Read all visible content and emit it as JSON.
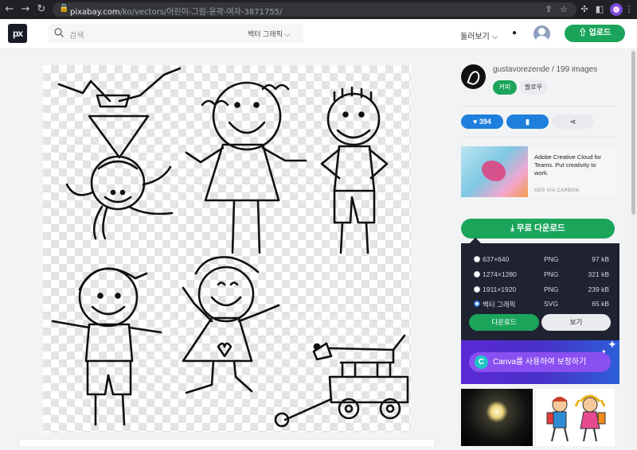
{
  "browser": {
    "url_host": "pixabay.com",
    "url_path": "/ko/vectors/어린이-그림-윤곽-여자-3871755/"
  },
  "header": {
    "logo": "px",
    "search_placeholder": "검색",
    "search_filter": "벡터 그래픽",
    "browse": "둘러보기",
    "upload": "업로드"
  },
  "author": {
    "name": "gustavorezende / 199 images",
    "coffee": "커피",
    "follow": "팔로우"
  },
  "actions": {
    "likes": "394"
  },
  "ad": {
    "text": "Adobe Creative Cloud for Teams. Put creativity to work.",
    "via": "ADS VIA CARBON"
  },
  "download": {
    "button": "무료 다운로드",
    "options": [
      {
        "size": "637×640",
        "format": "PNG",
        "filesize": "97 kB",
        "selected": false
      },
      {
        "size": "1274×1280",
        "format": "PNG",
        "filesize": "321 kB",
        "selected": false
      },
      {
        "size": "1911×1920",
        "format": "PNG",
        "filesize": "239 kB",
        "selected": false
      },
      {
        "size": "벡터 그래픽",
        "format": "SVG",
        "filesize": "65 kB",
        "selected": true
      }
    ],
    "download_label": "다운로드",
    "view_label": "보기"
  },
  "canva": {
    "logo": "C",
    "label": "Canva를 사용하여 보정하기"
  },
  "colors": {
    "brand_green": "#1aa55b",
    "like_blue": "#1e7fdc",
    "panel_dark": "#1f2230"
  }
}
